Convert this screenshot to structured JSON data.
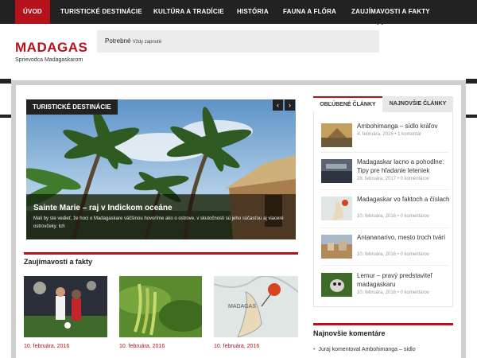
{
  "nav": {
    "items": [
      {
        "label": "Úvod"
      },
      {
        "label": "Turistické destinácie"
      },
      {
        "label": "Kultúra a tradície"
      },
      {
        "label": "História"
      },
      {
        "label": "Fauna a flóra"
      },
      {
        "label": "Zaujímavosti a fakty"
      }
    ]
  },
  "header": {
    "logo": "MADAGAS",
    "tagline": "Sprievodca Madagaskarom"
  },
  "cookie": {
    "label": "Potrebné",
    "status": "Vždy zapnuté",
    "close_icon": "close-icon"
  },
  "slider": {
    "category": "Turistické destinácie",
    "title": "Sainte Marie – raj v Indickom oceáne",
    "text": "Mali by ste vedieť, že hoci o Madagaskare väčšinou hovoríme ako o ostrove, v skutočnosti sú jeho súčasťou aj viaceré ostrovčeky. Ich",
    "prev_icon": "chevron-left-icon",
    "next_icon": "chevron-right-icon"
  },
  "facts": {
    "title": "Zaujímavosti a fakty",
    "items": [
      {
        "date": "10. februára, 2016"
      },
      {
        "date": "10. februára, 2016"
      },
      {
        "date": "10. februára, 2016"
      }
    ]
  },
  "sidebar": {
    "tabs": [
      {
        "label": "Obľúbené články"
      },
      {
        "label": "Najnovšie články"
      }
    ],
    "popular": [
      {
        "title": "Ambohimanga – sídlo kráľov",
        "meta": "4. februára, 2016 • 1 komentár"
      },
      {
        "title": "Madagaskar lacno a pohodlne: Tipy pre hľadanie leteniek",
        "meta": "28. februára, 2017 • 0 komentárov"
      },
      {
        "title": "Madagaskar vo faktoch a číslach",
        "meta": "10. februára, 2016 • 0 komentárov"
      },
      {
        "title": "Antananarivo, mesto troch tvárí",
        "meta": "10. februára, 2016 • 0 komentárov"
      },
      {
        "title": "Lemur – pravý predstaviteľ madagaskaru",
        "meta": "10. februára, 2016 • 0 komentárov"
      }
    ],
    "comments_title": "Najnovšie komentáre",
    "comments": [
      {
        "text": "Juraj komentoval Ambohimanga – sídlo"
      }
    ]
  },
  "colors": {
    "accent": "#b5121b",
    "nav_bg": "#222222"
  }
}
